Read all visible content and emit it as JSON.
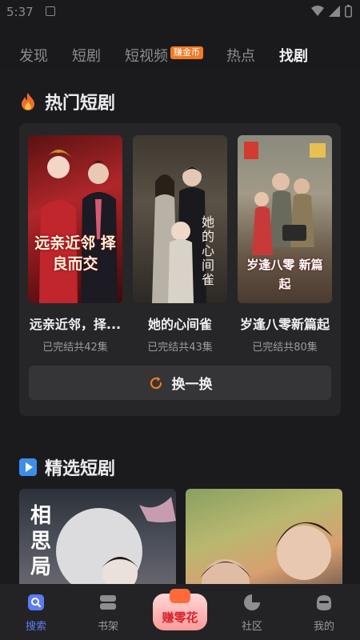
{
  "status": {
    "time": "5:37"
  },
  "top_tabs": [
    {
      "label": "发现"
    },
    {
      "label": "短剧"
    },
    {
      "label": "短视频",
      "badge": "赚金币"
    },
    {
      "label": "热点"
    },
    {
      "label": "找剧"
    }
  ],
  "hot": {
    "title": "热门短剧",
    "dramas": [
      {
        "title": "远亲近邻，择...",
        "meta": "已完结共42集",
        "cover_text": "远亲近邻 择良而交"
      },
      {
        "title": "她的心间雀",
        "meta": "已完结共43集",
        "cover_text": "她的心间雀"
      },
      {
        "title": "岁逢八零新篇起",
        "meta": "已完结共80集",
        "cover_text": "岁逢八零 新篇起"
      }
    ],
    "refresh_label": "换一换"
  },
  "featured": {
    "title": "精选短剧",
    "items": [
      {
        "cover_text": "相思局"
      },
      {
        "cover_text": ""
      }
    ]
  },
  "bottom_nav": {
    "items": [
      {
        "label": "搜索",
        "active": true
      },
      {
        "label": "书架"
      },
      {
        "label": "赚零花"
      },
      {
        "label": "社区"
      },
      {
        "label": "我的"
      }
    ]
  },
  "colors": {
    "accent": "#5b7cf5",
    "badge": "#f07a25",
    "refresh_icon": "#f07a25"
  }
}
